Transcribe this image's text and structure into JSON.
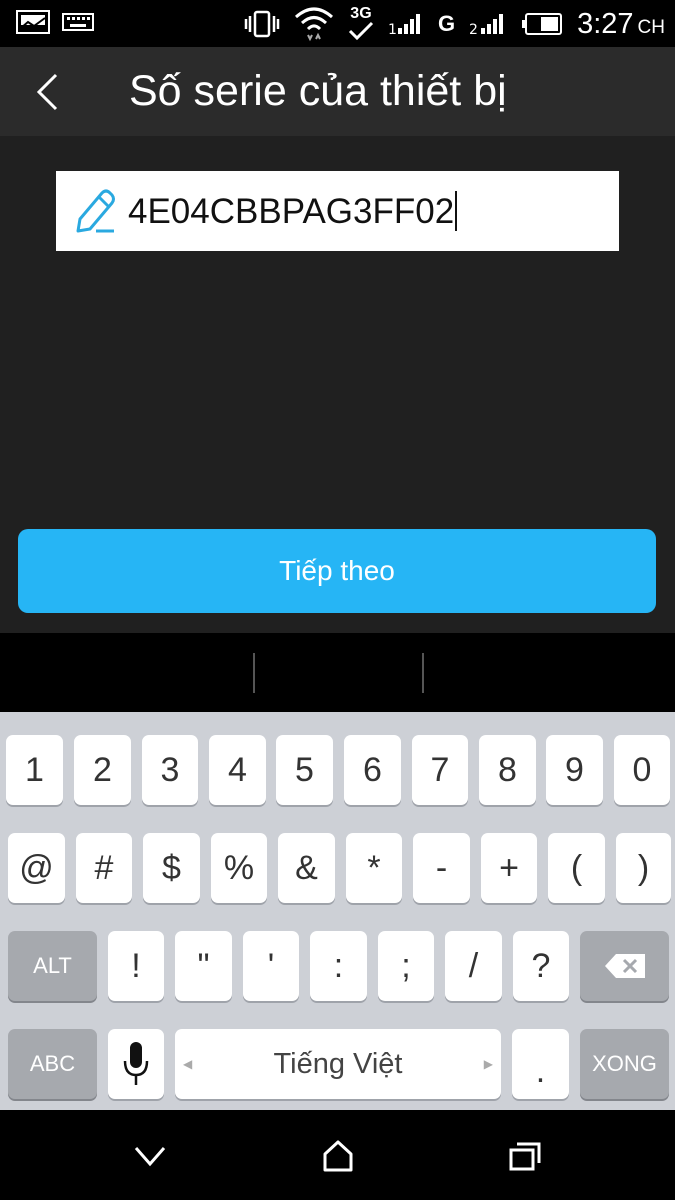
{
  "status_bar": {
    "time": "3:27",
    "ampm": "CH",
    "network_3g": "3G",
    "network_g": "G",
    "icons": [
      "screenshot-icon",
      "keyboard-icon",
      "vibrate-icon",
      "wifi-icon",
      "3g-icon",
      "signal-icon",
      "signal-icon",
      "battery-icon"
    ]
  },
  "app_bar": {
    "title": "Số serie của thiết bị",
    "back_icon": "chevron-left-icon"
  },
  "serial_input": {
    "value": "4E04CBBPAG3FF02",
    "icon": "pen-icon"
  },
  "next_button": {
    "label": "Tiếp theo",
    "color": "#26b5f5"
  },
  "keyboard": {
    "row1": [
      "1",
      "2",
      "3",
      "4",
      "5",
      "6",
      "7",
      "8",
      "9",
      "0"
    ],
    "row2": [
      "@",
      "#",
      "$",
      "%",
      "&",
      "*",
      "-",
      "+",
      "(",
      ")"
    ],
    "row3": {
      "alt": "ALT",
      "keys": [
        "!",
        "\"",
        "'",
        ":",
        ";",
        "/",
        "?"
      ],
      "backspace_icon": "backspace-icon"
    },
    "row4": {
      "abc": "ABC",
      "mic_icon": "microphone-icon",
      "language": "Tiếng Việt",
      "period": ".",
      "done": "XONG"
    }
  },
  "nav_bar": {
    "icons": [
      "back-chevron-icon",
      "home-icon",
      "recents-icon"
    ]
  }
}
